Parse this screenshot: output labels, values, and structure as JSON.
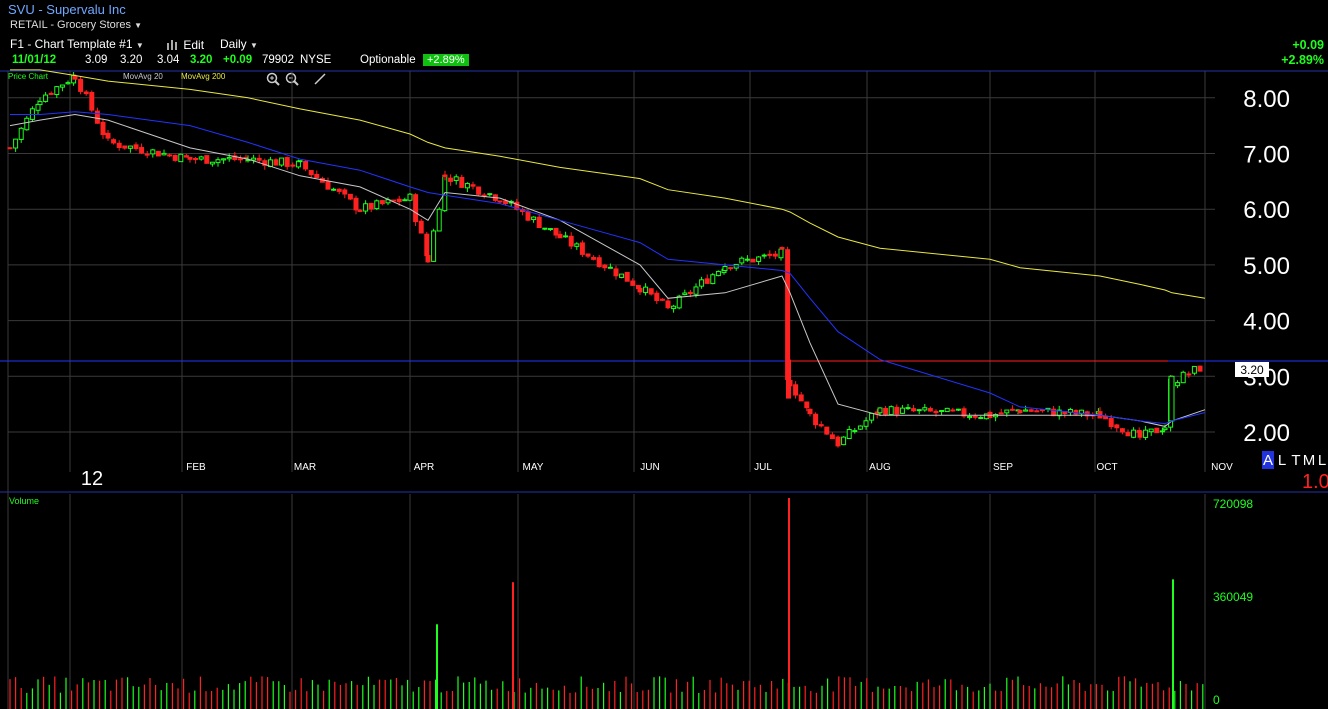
{
  "header": {
    "title": "SVU - Supervalu Inc",
    "sector": "RETAIL - Grocery Stores",
    "template": "F1 - Chart Template #1",
    "edit_label": "Edit",
    "interval": "Daily",
    "quote": {
      "date": "11/01/12",
      "open": "3.09",
      "high": "3.20",
      "low": "3.04",
      "last": "3.20",
      "change": "+0.09",
      "volume": "79902",
      "exchange": "NYSE",
      "optionable": "Optionable",
      "pct_change": "+2.89%"
    },
    "right_change": "+0.09",
    "right_pct": "+2.89%"
  },
  "legend": {
    "price_chart": "Price Chart",
    "ma20": "MovAvg 20",
    "ma200": "MovAvg 200"
  },
  "price_axis": {
    "ticks": [
      "8.00",
      "7.00",
      "6.00",
      "5.00",
      "4.00",
      "3.00",
      "2.00"
    ],
    "last_price_tag": "3.20",
    "scale_buttons": [
      "A",
      "L",
      "T",
      "M",
      "L"
    ],
    "corner_value": "1.0"
  },
  "time_axis": {
    "labels": [
      "12",
      "FEB",
      "MAR",
      "APR",
      "MAY",
      "JUN",
      "JUL",
      "AUG",
      "SEP",
      "OCT",
      "NOV"
    ]
  },
  "volume_panel": {
    "label": "Volume",
    "ticks": [
      "720098",
      "360049",
      "0"
    ]
  },
  "colors": {
    "up": "#1eff1e",
    "down": "#ff2020",
    "ma20": "#c8c8c8",
    "ma50": "#2233ff",
    "ma200": "#e8e840",
    "grid": "#3a3a3a",
    "panel_border": "#2233aa"
  },
  "chart_data": [
    {
      "type": "candlestick",
      "title": "SVU - Supervalu Inc",
      "interval": "Daily",
      "y_range": [
        1.7,
        8.5
      ],
      "x_labels": [
        "FEB",
        "MAR",
        "APR",
        "MAY",
        "JUN",
        "JUL",
        "AUG",
        "SEP",
        "OCT",
        "NOV"
      ],
      "price_keypoints": [
        {
          "t": "Jan 3",
          "close": 7.1
        },
        {
          "t": "Jan 10",
          "close": 8.0
        },
        {
          "t": "Jan 17",
          "close": 8.4
        },
        {
          "t": "Jan 24",
          "close": 7.2
        },
        {
          "t": "Feb 1",
          "close": 6.9
        },
        {
          "t": "Feb 15",
          "close": 6.9
        },
        {
          "t": "Mar 1",
          "close": 6.8
        },
        {
          "t": "Mar 15",
          "close": 6.0
        },
        {
          "t": "Apr 2",
          "close": 6.2
        },
        {
          "t": "Apr 10",
          "close": 5.1
        },
        {
          "t": "Apr 20",
          "close": 6.6
        },
        {
          "t": "May 1",
          "close": 6.2
        },
        {
          "t": "May 15",
          "close": 5.5
        },
        {
          "t": "Jun 1",
          "close": 4.6
        },
        {
          "t": "Jun 15",
          "close": 4.2
        },
        {
          "t": "Jul 1",
          "close": 5.0
        },
        {
          "t": "Jul 10",
          "close": 5.2
        },
        {
          "t": "Jul 12",
          "close": 2.9
        },
        {
          "t": "Jul 20",
          "close": 2.3
        },
        {
          "t": "Aug 1",
          "close": 1.8
        },
        {
          "t": "Aug 15",
          "close": 2.4
        },
        {
          "t": "Sep 1",
          "close": 2.3
        },
        {
          "t": "Sep 15",
          "close": 2.4
        },
        {
          "t": "Oct 1",
          "close": 2.3
        },
        {
          "t": "Oct 15",
          "close": 1.9
        },
        {
          "t": "Oct 22",
          "close": 2.1
        },
        {
          "t": "Oct 25",
          "close": 2.9
        },
        {
          "t": "Nov 1",
          "close": 3.2
        }
      ],
      "series": [
        {
          "name": "MovAvg 20",
          "values_at_keypoints": [
            7.5,
            7.6,
            7.7,
            7.6,
            7.1,
            6.9,
            6.6,
            6.4,
            6.0,
            5.8,
            6.3,
            6.2,
            5.8,
            5.0,
            4.4,
            4.5,
            4.8,
            4.5,
            3.6,
            2.5,
            2.3,
            2.3,
            2.3,
            2.3,
            2.2,
            2.1,
            2.2,
            2.4
          ]
        },
        {
          "name": "MovAvg 200",
          "values_at_keypoints": [
            8.5,
            8.5,
            8.4,
            8.3,
            8.15,
            8.0,
            7.8,
            7.6,
            7.35,
            7.2,
            7.1,
            6.95,
            6.75,
            6.55,
            6.35,
            6.2,
            6.0,
            5.95,
            5.75,
            5.5,
            5.3,
            5.1,
            4.95,
            4.8,
            4.65,
            4.55,
            4.5,
            4.4
          ]
        }
      ]
    },
    {
      "type": "bar",
      "title": "Volume",
      "y_range": [
        0,
        720098
      ],
      "spikes": [
        {
          "t": "Apr 2",
          "value": 270000,
          "color": "up"
        },
        {
          "t": "May 1",
          "value": 420000,
          "color": "down"
        },
        {
          "t": "Jul 12",
          "value": 720098,
          "color": "down"
        },
        {
          "t": "Oct 25",
          "value": 430000,
          "color": "up"
        }
      ]
    }
  ]
}
